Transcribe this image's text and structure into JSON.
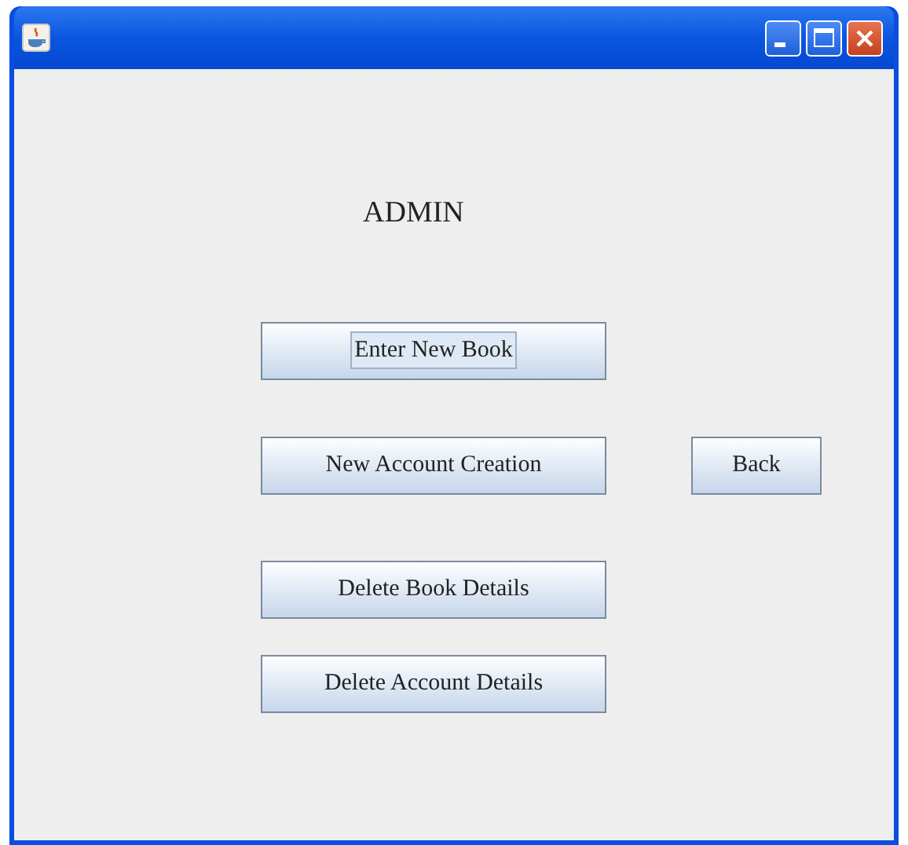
{
  "window": {
    "title_buttons": [
      {
        "kind": "minimize"
      },
      {
        "kind": "maximize"
      },
      {
        "kind": "close"
      }
    ]
  },
  "heading": "ADMIN",
  "buttons": [
    {
      "label": "Enter New Book",
      "focused": true
    },
    {
      "label": "New Account Creation",
      "focused": false
    },
    {
      "label": "Back",
      "focused": false
    },
    {
      "label": "Delete Book Details",
      "focused": false
    },
    {
      "label": "Delete Account Details",
      "focused": false
    }
  ]
}
